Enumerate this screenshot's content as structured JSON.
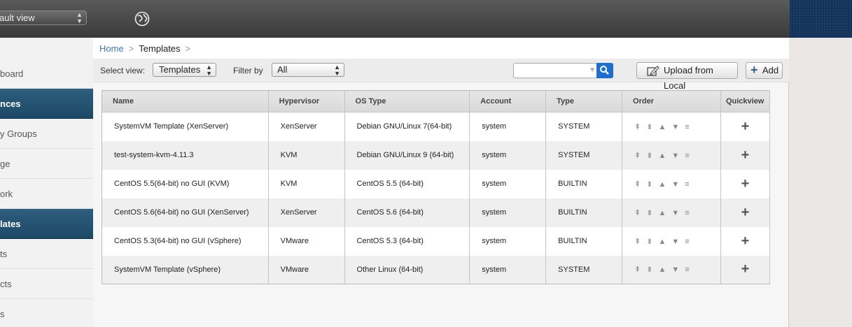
{
  "header": {
    "project_select": "ault view"
  },
  "sidebar": {
    "items": [
      {
        "label": "board",
        "active": false
      },
      {
        "label": "nces",
        "active": true
      },
      {
        "label": "y Groups",
        "active": false
      },
      {
        "label": "ge",
        "active": false
      },
      {
        "label": "ork",
        "active": false
      },
      {
        "label": "lates",
        "active": true
      },
      {
        "label": "ts",
        "active": false
      },
      {
        "label": "cts",
        "active": false
      },
      {
        "label": "s",
        "active": false
      }
    ]
  },
  "breadcrumb": {
    "home": "Home",
    "sep": ">",
    "current": "Templates",
    "trailing_sep": ">"
  },
  "toolbar": {
    "select_view_label": "Select view:",
    "select_view_value": "Templates",
    "filter_label": "Filter by",
    "filter_value": "All",
    "search_value": "",
    "upload_label": "Upload from Local",
    "add_label": "Add"
  },
  "table": {
    "columns": [
      "Name",
      "Hypervisor",
      "OS Type",
      "Account",
      "Type",
      "Order",
      "Quickview"
    ],
    "rows": [
      {
        "name": "SystemVM Template (XenServer)",
        "hypervisor": "XenServer",
        "os": "Debian GNU/Linux 7(64-bit)",
        "account": "system",
        "type": "SYSTEM"
      },
      {
        "name": "test-system-kvm-4.11.3",
        "hypervisor": "KVM",
        "os": "Debian GNU/Linux 9 (64-bit)",
        "account": "system",
        "type": "SYSTEM"
      },
      {
        "name": "CentOS 5.5(64-bit) no GUI (KVM)",
        "hypervisor": "KVM",
        "os": "CentOS 5.5 (64-bit)",
        "account": "system",
        "type": "BUILTIN"
      },
      {
        "name": "CentOS 5.6(64-bit) no GUI (XenServer)",
        "hypervisor": "XenServer",
        "os": "CentOS 5.6 (64-bit)",
        "account": "system",
        "type": "BUILTIN"
      },
      {
        "name": "CentOS 5.3(64-bit) no GUI (vSphere)",
        "hypervisor": "VMware",
        "os": "CentOS 5.3 (64-bit)",
        "account": "system",
        "type": "BUILTIN"
      },
      {
        "name": "SystemVM Template (vSphere)",
        "hypervisor": "VMware",
        "os": "Other Linux (64-bit)",
        "account": "system",
        "type": "SYSTEM"
      }
    ]
  },
  "colors": {
    "accent": "#3b7bbf",
    "sidebar_active": "#1c4966",
    "search_button": "#1d6fcf"
  },
  "icons": {
    "order": [
      "move-top-icon",
      "move-bottom-icon",
      "move-up-icon",
      "move-down-icon",
      "drag-handle-icon"
    ],
    "quickview": "plus-icon"
  }
}
